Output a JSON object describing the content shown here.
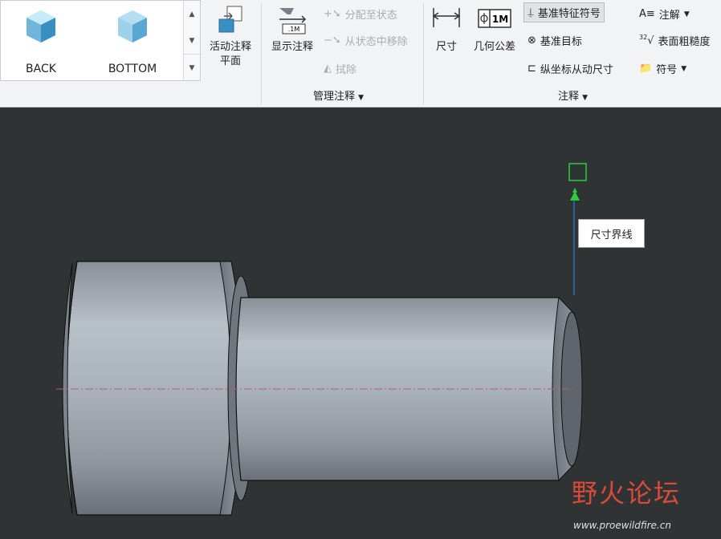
{
  "views": {
    "items": [
      {
        "label": "BACK"
      },
      {
        "label": "BOTTOM"
      }
    ],
    "colors": {
      "cube_light": "#9fd6ea",
      "cube_dark": "#3a8fc2"
    }
  },
  "ribbon": {
    "active_plane": {
      "line1": "活动注释",
      "line2": "平面"
    },
    "show_annotation": "显示注释",
    "assign_state": "分配至状态",
    "remove_state": "从状态中移除",
    "erase": "拭除",
    "group_manage": "管理注释",
    "dimension": "尺寸",
    "gtol": "几何公差",
    "datum_feature": "基准特征符号",
    "datum_target": "基准目标",
    "ordinate": "纵坐标从动尺寸",
    "note": "注解",
    "surface_finish": "表面粗糙度",
    "symbol": "符号",
    "group_annotation": "注释",
    "gtol_icon_text": "1M",
    "show_icon_text": ".1M",
    "finish_icon_text": "32"
  },
  "viewport": {
    "tooltip": "尺寸界线",
    "background": "#2f3334",
    "leader_color": "#2b7fd0",
    "handle_color": "#2ecc40"
  },
  "watermark": {
    "title": "野火论坛",
    "url": "www.proewildfire.cn"
  }
}
